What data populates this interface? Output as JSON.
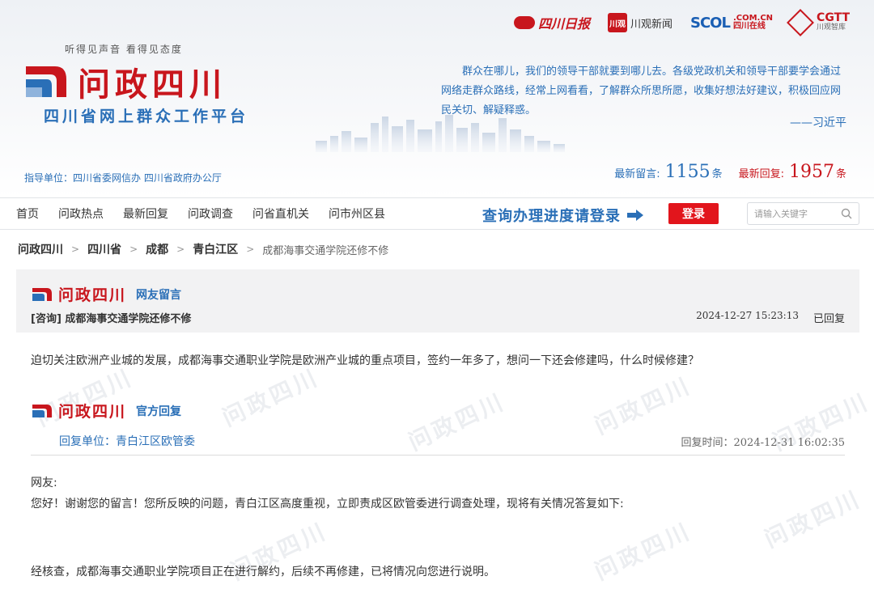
{
  "partners": {
    "sichuan_daily": "四川日报",
    "chuanguan_icon": "川观",
    "chuanguan": "川观新闻",
    "scol": "SCOL",
    "scol_sub1": ".COM.CN",
    "scol_sub2": "四川在线",
    "cgtt": "CGTT",
    "cgtt_sub": "川观智库"
  },
  "header": {
    "slogan": "听得见声音  看得见态度",
    "logo_text": "问政四川",
    "subtitle": "四川省网上群众工作平台",
    "guide": "指导单位：四川省委网信办 四川省政府办公厅",
    "quote": "群众在哪儿，我们的领导干部就要到哪儿去。各级党政机关和领导干部要学会通过网络走群众路线，经常上网看看，了解群众所思所愿，收集好想法好建议，积极回应网民关切、解疑释惑。",
    "quote_author": "——习近平",
    "stats": {
      "latest_msg_label": "最新留言:",
      "latest_msg_count": "1155",
      "latest_msg_unit": "条",
      "latest_reply_label": "最新回复:",
      "latest_reply_count": "1957",
      "latest_reply_unit": "条"
    }
  },
  "nav": {
    "items": [
      "首页",
      "问政热点",
      "最新回复",
      "问政调查",
      "问省直机关",
      "问市州区县"
    ],
    "progress_text": "查询办理进度请登录",
    "login_label": "登录",
    "search_placeholder": "请输入关键字"
  },
  "breadcrumb": {
    "items": [
      "问政四川",
      "四川省",
      "成都",
      "青白江区"
    ],
    "current": "成都海事交通学院还修不修"
  },
  "message": {
    "section_logo": "问政四川",
    "section_tag": "网友留言",
    "title": "[咨询] 成都海事交通学院还修不修",
    "time": "2024-12-27 15:23:13",
    "status": "已回复",
    "body": "迫切关注欧洲产业城的发展，成都海事交通职业学院是欧洲产业城的重点项目，签约一年多了，想问一下还会修建吗，什么时候修建？"
  },
  "reply": {
    "section_logo": "问政四川",
    "section_tag": "官方回复",
    "unit_label": "回复单位：",
    "unit": "青白江区欧管委",
    "time_label": "回复时间：",
    "time": "2024-12-31 16:02:35",
    "greeting": "网友:",
    "p1": "您好！谢谢您的留言！您所反映的问题，青白江区高度重视，立即责成区欧管委进行调查处理，现将有关情况答复如下:",
    "p2": "经核查，成都海事交通职业学院项目正在进行解约，后续不再修建，已将情况向您进行说明。"
  },
  "colors": {
    "brand_red": "#c8161d",
    "brand_blue": "#2a6fb7",
    "login_red": "#e2151c"
  }
}
